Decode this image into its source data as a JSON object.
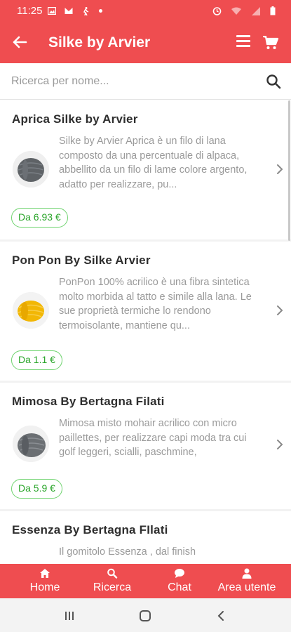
{
  "status_bar": {
    "time": "11:25",
    "left_icons": [
      "photo-icon",
      "mail-icon",
      "walk-icon",
      "dot-icon"
    ],
    "right_icons": [
      "alarm-icon",
      "wifi-icon",
      "signal-icon",
      "battery-icon"
    ]
  },
  "app_bar": {
    "title": "Silke by Arvier",
    "back_icon": "arrow-left-icon",
    "menu_icon": "hamburger-icon",
    "cart_icon": "cart-icon"
  },
  "search": {
    "placeholder": "Ricerca per nome...",
    "value": ""
  },
  "products": [
    {
      "name": "Aprica Silke by Arvier",
      "description": "Silke by Arvier Aprica è un filo di lana composto da una percentuale di alpaca, abbellito da un filo di lame colore argento, adatto per realizzare, pu...",
      "price": "Da 6.93 €",
      "yarn_color": "#5e6266"
    },
    {
      "name": "Pon Pon By Silke Arvier",
      "description": "PonPon 100% acrilico è una fibra sintetica molto morbida al tatto e simile alla lana.  Le sue proprietà termiche lo rendono termoisolante, mantiene qu...",
      "price": "Da 1.1 €",
      "yarn_color": "#f2b705"
    },
    {
      "name": "Mimosa By Bertagna Filati",
      "description": "Mimosa misto mohair acrilico con micro paillettes, per realizzare capi moda tra cui golf leggeri, scialli, paschmine,",
      "price": "Da 5.9 €",
      "yarn_color": "#6b6f73"
    },
    {
      "name": "Essenza By Bertagna FIlati",
      "description": "Il gomitolo Essenza , dal finish",
      "price": "",
      "yarn_color": "#cccccc"
    }
  ],
  "bottom_nav": [
    {
      "label": "Home",
      "icon": "home-icon"
    },
    {
      "label": "Ricerca",
      "icon": "search-icon"
    },
    {
      "label": "Chat",
      "icon": "chat-icon"
    },
    {
      "label": "Area utente",
      "icon": "user-icon"
    }
  ],
  "colors": {
    "primary": "#ef4d50",
    "price_text": "#2aa52a",
    "price_border": "#6fd36f"
  }
}
